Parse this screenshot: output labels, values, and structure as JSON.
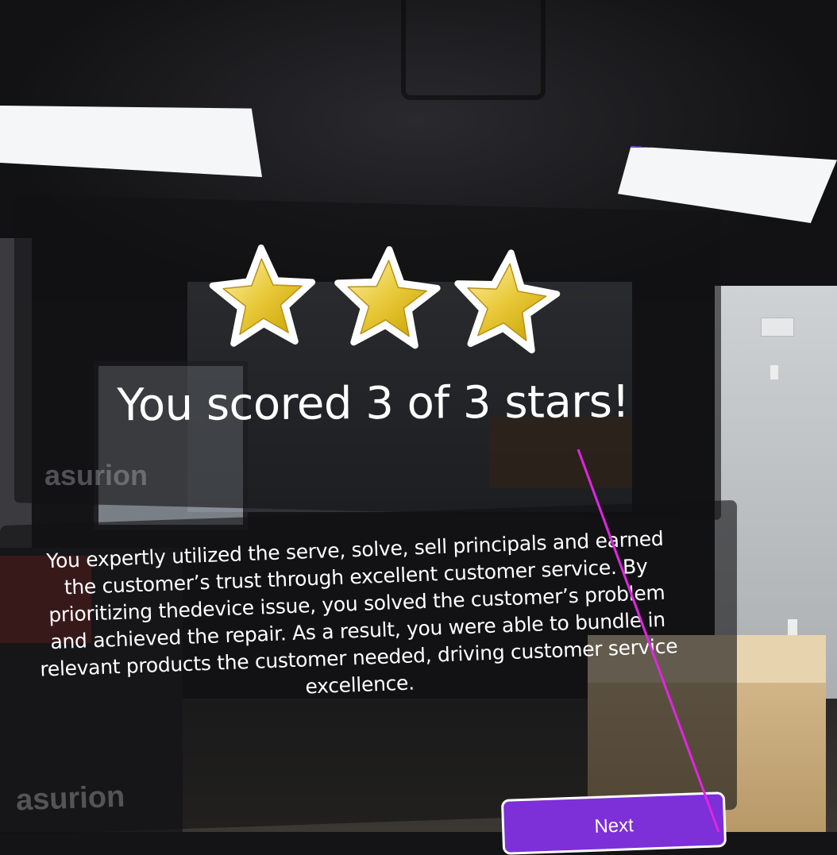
{
  "result": {
    "stars_earned": 3,
    "stars_total": 3,
    "title": "You scored 3 of 3 stars!",
    "summary": "You expertly utilized the serve, solve, sell principals and earned the customer’s trust through excellent customer service. By prioritizing thedevice issue, you solved the customer’s problem and achieved the repair. As a result, you were able to bundle in relevant products the customer needed, driving customer service excellence."
  },
  "background": {
    "watermark_text": "asurion"
  },
  "actions": {
    "next_label": "Next"
  },
  "colors": {
    "accent": "#7d2fd8",
    "star_fill_light": "#fff2a8",
    "star_fill_dark": "#c9a200",
    "pointer_ray": "#e026e0"
  },
  "icons": {
    "star": "star-icon"
  }
}
